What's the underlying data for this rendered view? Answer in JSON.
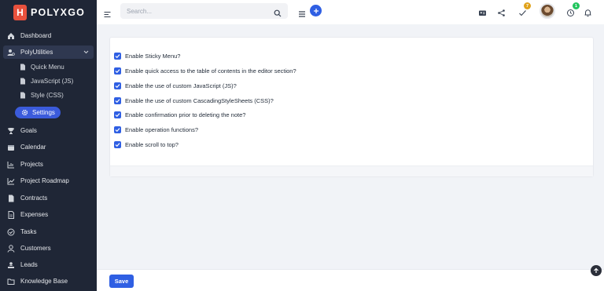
{
  "app": {
    "logo_letter": "H",
    "name": "POLYXGO"
  },
  "search": {
    "placeholder": "Search..."
  },
  "header": {
    "tasks_badge": "7",
    "notif_badge": "1",
    "accent": "#2f5fe3"
  },
  "sidebar": {
    "items": [
      {
        "label": "Dashboard",
        "icon": "home-icon"
      },
      {
        "label": "PolyUtilities",
        "icon": "user-gear-icon"
      },
      {
        "label": "Goals",
        "icon": "trophy-icon"
      },
      {
        "label": "Calendar",
        "icon": "calendar-icon"
      },
      {
        "label": "Projects",
        "icon": "chart-icon"
      },
      {
        "label": "Project Roadmap",
        "icon": "roadmap-icon"
      },
      {
        "label": "Contracts",
        "icon": "file-icon"
      },
      {
        "label": "Expenses",
        "icon": "file-icon"
      },
      {
        "label": "Tasks",
        "icon": "check-circle-icon"
      },
      {
        "label": "Customers",
        "icon": "user-icon"
      },
      {
        "label": "Leads",
        "icon": "leads-icon"
      },
      {
        "label": "Knowledge Base",
        "icon": "folder-icon"
      }
    ],
    "sub_items": [
      {
        "label": "Quick Menu"
      },
      {
        "label": "JavaScript (JS)"
      },
      {
        "label": "Style (CSS)"
      }
    ],
    "active": {
      "label": "Settings",
      "icon": "gear-icon"
    }
  },
  "options": [
    {
      "label": "Enable Sticky Menu?",
      "checked": true
    },
    {
      "label": "Enable quick access to the table of contents in the editor section?",
      "checked": true
    },
    {
      "label": "Enable the use of custom JavaScript (JS)?",
      "checked": true
    },
    {
      "label": "Enable the use of custom CascadingStyleSheets (CSS)?",
      "checked": true
    },
    {
      "label": "Enable confirmation prior to deleting the note?",
      "checked": true
    },
    {
      "label": "Enable operation functions?",
      "checked": true
    },
    {
      "label": "Enable scroll to top?",
      "checked": true
    }
  ],
  "footer": {
    "save_label": "Save"
  }
}
